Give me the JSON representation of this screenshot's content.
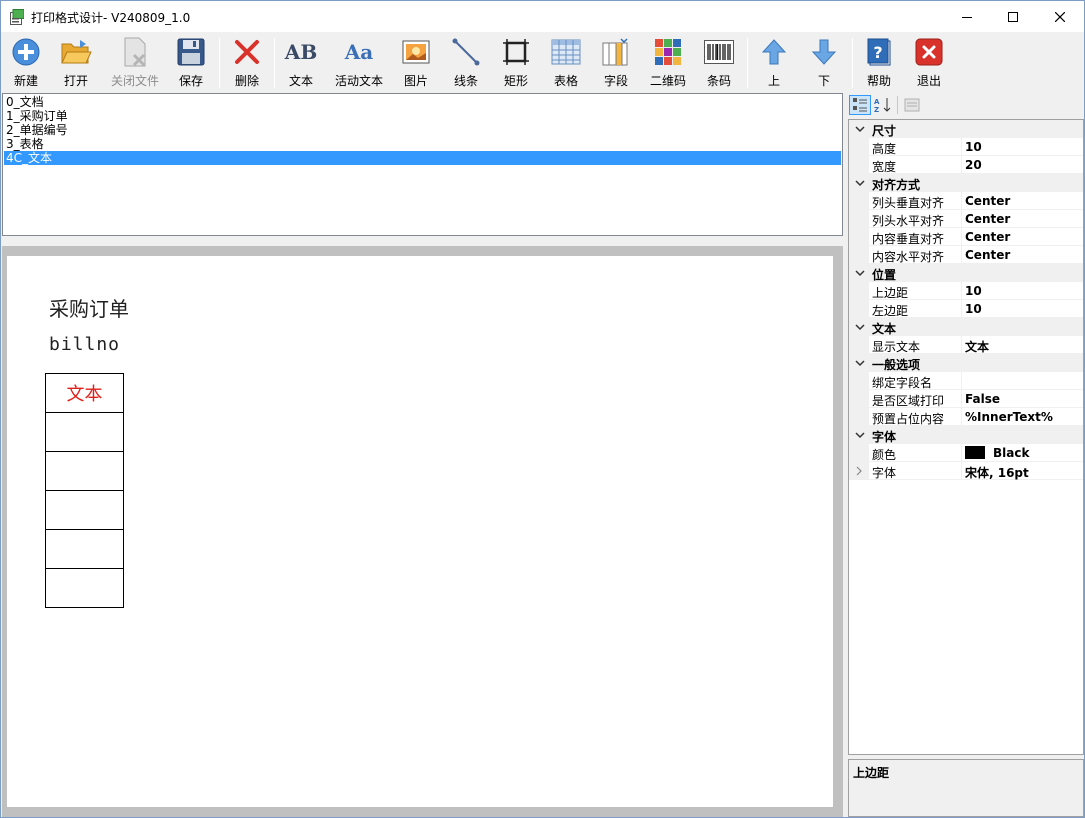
{
  "window": {
    "title": "打印格式设计- V240809_1.0"
  },
  "toolbar": {
    "new": "新建",
    "open": "打开",
    "close_file": "关闭文件",
    "save": "保存",
    "delete": "删除",
    "text": "文本",
    "dynamic_text": "活动文本",
    "image": "图片",
    "line": "线条",
    "rectangle": "矩形",
    "table": "表格",
    "field": "字段",
    "qrcode": "二维码",
    "barcode": "条码",
    "up": "上",
    "down": "下",
    "help": "帮助",
    "exit": "退出",
    "text_icon_glyph": "AB",
    "dynamic_text_icon_glyph": "Aa"
  },
  "layers": [
    {
      "label": "0_文档",
      "selected": false
    },
    {
      "label": "1_采购订单",
      "selected": false
    },
    {
      "label": "2_单据编号",
      "selected": false
    },
    {
      "label": "3_表格",
      "selected": false
    },
    {
      "label": "4C_文本",
      "selected": true
    }
  ],
  "canvas": {
    "title_text": "采购订单",
    "billno_text": "billno",
    "table_header_text": "文本",
    "table_body_rows": 5
  },
  "properties": {
    "categories": [
      {
        "name": "尺寸",
        "items": [
          {
            "name": "高度",
            "value": "10"
          },
          {
            "name": "宽度",
            "value": "20"
          }
        ]
      },
      {
        "name": "对齐方式",
        "items": [
          {
            "name": "列头垂直对齐",
            "value": "Center"
          },
          {
            "name": "列头水平对齐",
            "value": "Center"
          },
          {
            "name": "内容垂直对齐",
            "value": "Center"
          },
          {
            "name": "内容水平对齐",
            "value": "Center"
          }
        ]
      },
      {
        "name": "位置",
        "items": [
          {
            "name": "上边距",
            "value": "10"
          },
          {
            "name": "左边距",
            "value": "10"
          }
        ]
      },
      {
        "name": "文本",
        "items": [
          {
            "name": "显示文本",
            "value": "文本"
          }
        ]
      },
      {
        "name": "一般选项",
        "items": [
          {
            "name": "绑定字段名",
            "value": ""
          },
          {
            "name": "是否区域打印",
            "value": "False"
          },
          {
            "name": "预置占位内容",
            "value": "%InnerText%"
          }
        ]
      },
      {
        "name": "字体",
        "items": [
          {
            "name": "颜色",
            "value": "Black",
            "swatch": "#000000"
          },
          {
            "name": "字体",
            "value": "宋体, 16pt",
            "expandable": true
          }
        ]
      }
    ],
    "description_title": "上边距"
  },
  "colors": {
    "selection": "#3399ff",
    "canvas_header_text": "#e0201a",
    "exit_red": "#d9322b",
    "help_blue": "#2f6db8"
  }
}
